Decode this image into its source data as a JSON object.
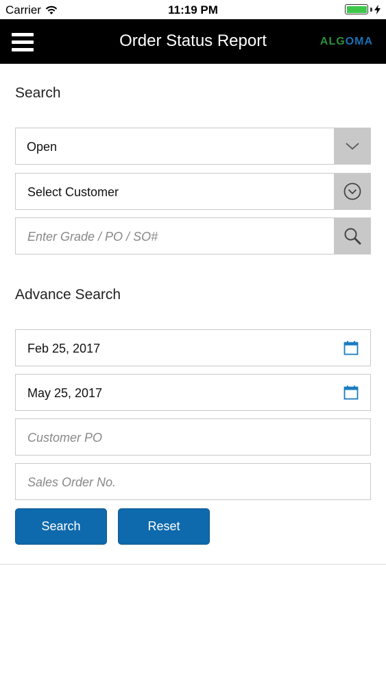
{
  "status_bar": {
    "carrier": "Carrier",
    "time": "11:19 PM"
  },
  "header": {
    "title": "Order Status Report",
    "logo_text_part1": "ALG",
    "logo_text_part2": "OMA",
    "logo_colors": [
      "#2f8f3a",
      "#1a6fb3"
    ]
  },
  "search": {
    "heading": "Search",
    "status_select": {
      "value": "Open",
      "icon": "chevron-down-icon"
    },
    "customer_select": {
      "value": "Select Customer",
      "icon": "circle-chevron-down-icon"
    },
    "query_input": {
      "placeholder": "Enter Grade / PO / SO#",
      "icon": "search-icon"
    }
  },
  "advance_search": {
    "heading": "Advance Search",
    "from_date": {
      "value": "Feb 25, 2017",
      "icon": "calendar-icon"
    },
    "to_date": {
      "value": "May 25, 2017",
      "icon": "calendar-icon"
    },
    "customer_po": {
      "placeholder": "Customer PO"
    },
    "sales_order": {
      "placeholder": "Sales Order No."
    }
  },
  "actions": {
    "search_label": "Search",
    "reset_label": "Reset"
  },
  "colors": {
    "primary": "#0f6aad",
    "nav_bg": "#000000",
    "side_button": "#c8c8c8",
    "calendar": "#1a7cc1"
  }
}
